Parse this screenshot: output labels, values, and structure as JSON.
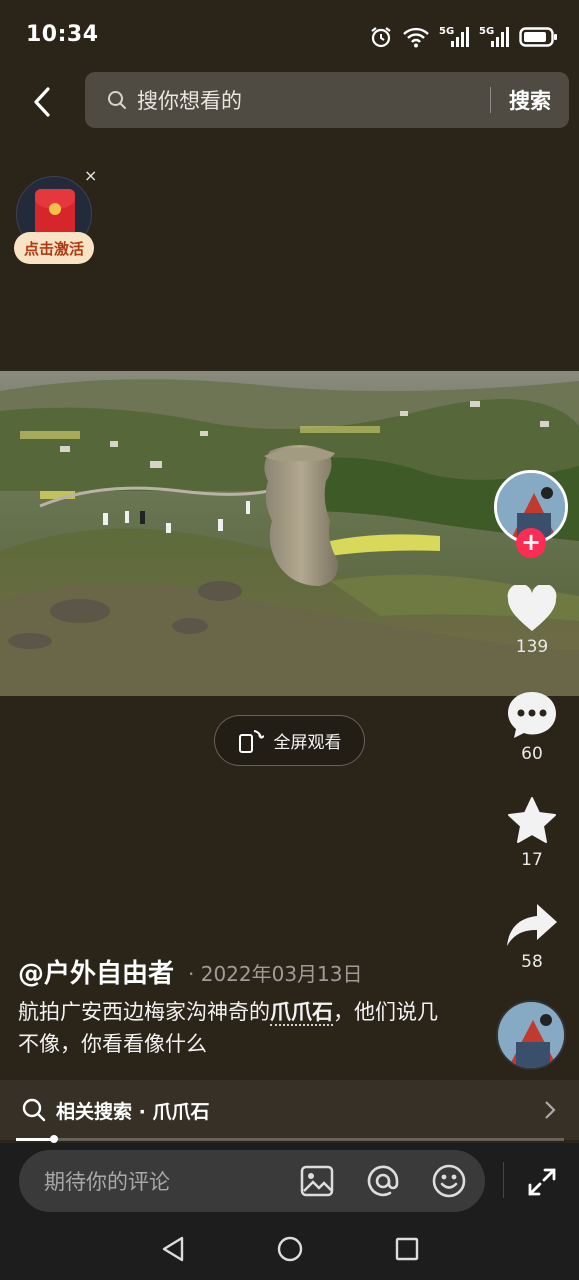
{
  "status_bar": {
    "time": "10:34",
    "network1": "5G",
    "network2": "5G"
  },
  "search": {
    "placeholder": "搜你想看的",
    "button_label": "搜索"
  },
  "red_packet": {
    "label": "点击激活",
    "close": "×"
  },
  "fullscreen": {
    "label": "全屏观看"
  },
  "actions": {
    "like_count": "139",
    "comment_count": "60",
    "favorite_count": "17",
    "share_count": "58"
  },
  "post": {
    "author": "@户外自由者",
    "date": "· 2022年03月13日",
    "caption_before": "航拍广安西边梅家沟神奇的",
    "caption_highlight": "爪爪石",
    "caption_after": "，他们说几不像，你看看像什么"
  },
  "related": {
    "label": "相关搜索 · 爪爪石"
  },
  "playback": {
    "progress": 0.07
  },
  "comment": {
    "placeholder": "期待你的评论"
  },
  "colors": {
    "accent": "#fe2c55",
    "background": "#2a2419"
  }
}
